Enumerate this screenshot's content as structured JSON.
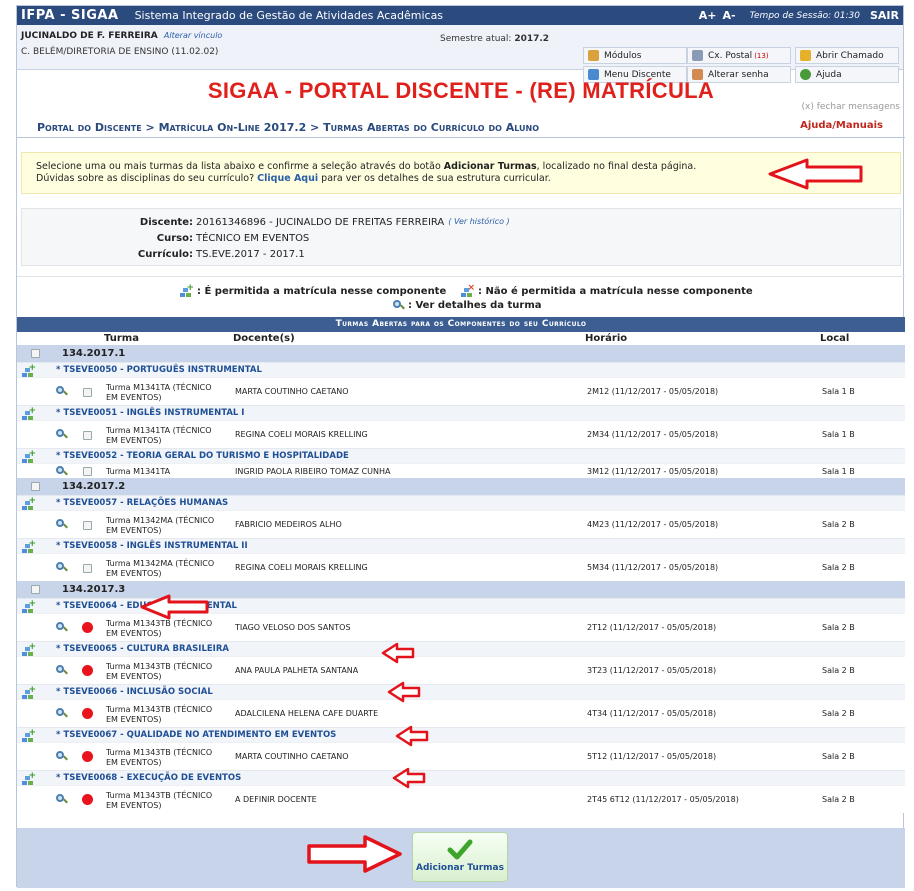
{
  "topbar": {
    "brand": "IFPA - SIGAA",
    "system": "Sistema Integrado de Gestão de Atividades Acadêmicas",
    "font_up": "A+",
    "font_down": "A-",
    "session_label": "Tempo de Sessão: 01:30",
    "exit": "SAIR"
  },
  "user": {
    "name": "JUCINALDO DE F. FERREIRA",
    "change_link": "Alterar vínculo",
    "unit": "C. BELÉM/DIRETORIA DE ENSINO (11.02.02)",
    "semester_label": "Semestre atual:",
    "semester_value": "2017.2"
  },
  "quick_buttons": {
    "modules": "Módulos",
    "mail": "Cx. Postal",
    "mail_count": "(13)",
    "ticket": "Abrir Chamado",
    "student_menu": "Menu Discente",
    "password": "Alterar senha",
    "help": "Ajuda"
  },
  "page_title": "SIGAA - PORTAL DISCENTE - (RE) MATRÍCULA",
  "close_messages": "(x) fechar mensagens",
  "breadcrumb": "Portal do Discente > Matrícula On-Line 2017.2 > Turmas Abertas do Currículo do Aluno",
  "help_link": "Ajuda/Manuais",
  "info": {
    "line1_a": "Selecione uma ou mais turmas da lista abaixo e confirme a seleção através do botão ",
    "line1_b": "Adicionar Turmas",
    "line1_c": ", localizado no final desta página.",
    "line2_a": "Dúvidas sobre as disciplinas do seu currículo? ",
    "line2_link": "Clique Aqui",
    "line2_b": " para ver os detalhes de sua estrutura curricular."
  },
  "student": {
    "discente_label": "Discente:",
    "discente_value": "20161346896 - JUCINALDO DE FREITAS FERREIRA",
    "history_link": "( Ver histórico )",
    "curso_label": "Curso:",
    "curso_value": "TÉCNICO EM EVENTOS",
    "curriculo_label": "Currículo:",
    "curriculo_value": "TS.EVE.2017 - 2017.1"
  },
  "legend": {
    "allowed": ": É permitida a matrícula nesse componente",
    "not_allowed": ": Não é permitida a matrícula nesse componente",
    "details": ": Ver detalhes da turma"
  },
  "table": {
    "title": "Turmas Abertas para os Componentes do seu Currículo",
    "col_turma": "Turma",
    "col_docente": "Docente(s)",
    "col_horario": "Horário",
    "col_local": "Local",
    "groups": [
      {
        "label": "134.2017.1",
        "components": [
          {
            "code": "* TSEVE0050 - PORTUGUÊS INSTRUMENTAL",
            "turma": "Turma M1341TA (TÉCNICO EM EVENTOS)",
            "docente": "MARTA COUTINHO CAETANO",
            "horario": "2M12 (11/12/2017 - 05/05/2018)",
            "local": "Sala 1 B",
            "selected": false
          },
          {
            "code": "* TSEVE0051 - INGLÊS INSTRUMENTAL I",
            "turma": "Turma M1341TA (TÉCNICO EM EVENTOS)",
            "docente": "REGINA COELI MORAIS KRELLING",
            "horario": "2M34 (11/12/2017 - 05/05/2018)",
            "local": "Sala 1 B",
            "selected": false
          },
          {
            "code": "* TSEVE0052 - TEORIA GERAL DO TURISMO E HOSPITALIDADE",
            "turma": "Turma M1341TA",
            "docente": "INGRID PAOLA RIBEIRO TOMAZ CUNHA",
            "horario": "3M12 (11/12/2017 - 05/05/2018)",
            "local": "Sala 1 B",
            "selected": false
          }
        ]
      },
      {
        "label": "134.2017.2",
        "components": [
          {
            "code": "* TSEVE0057 - RELAÇÕES HUMANAS",
            "turma": "Turma M1342MA (TÉCNICO EM EVENTOS)",
            "docente": "FABRICIO MEDEIROS ALHO",
            "horario": "4M23 (11/12/2017 - 05/05/2018)",
            "local": "Sala 2 B",
            "selected": false
          },
          {
            "code": "* TSEVE0058 - INGLÊS INSTRUMENTAL II",
            "turma": "Turma M1342MA (TÉCNICO EM EVENTOS)",
            "docente": "REGINA COELI MORAIS KRELLING",
            "horario": "5M34 (11/12/2017 - 05/05/2018)",
            "local": "Sala 2 B",
            "selected": false
          }
        ]
      },
      {
        "label": "134.2017.3",
        "components": [
          {
            "code": "* TSEVE0064 - EDUCAÇÃO AMBIENTAL",
            "turma": "Turma M1343TB (TÉCNICO EM EVENTOS)",
            "docente": "TIAGO VELOSO DOS SANTOS",
            "horario": "2T12 (11/12/2017 - 05/05/2018)",
            "local": "Sala 2 B",
            "selected": true
          },
          {
            "code": "* TSEVE0065 - CULTURA BRASILEIRA",
            "turma": "Turma M1343TB (TÉCNICO EM EVENTOS)",
            "docente": "ANA PAULA PALHETA SANTANA",
            "horario": "3T23 (11/12/2017 - 05/05/2018)",
            "local": "Sala 2 B",
            "selected": true
          },
          {
            "code": "* TSEVE0066 - INCLUSÃO SOCIAL",
            "turma": "Turma M1343TB (TÉCNICO EM EVENTOS)",
            "docente": "ADALCILENA HELENA CAFE DUARTE",
            "horario": "4T34 (11/12/2017 - 05/05/2018)",
            "local": "Sala 2 B",
            "selected": true
          },
          {
            "code": "* TSEVE0067 - QUALIDADE NO ATENDIMENTO EM EVENTOS",
            "turma": "Turma M1343TB (TÉCNICO EM EVENTOS)",
            "docente": "MARTA COUTINHO CAETANO",
            "horario": "5T12 (11/12/2017 - 05/05/2018)",
            "local": "Sala 2 B",
            "selected": true
          },
          {
            "code": "* TSEVE0068 - EXECUÇÃO DE EVENTOS",
            "turma": "Turma M1343TB (TÉCNICO EM EVENTOS)",
            "docente": "A DEFINIR DOCENTE",
            "horario": "2T45 6T12 (11/12/2017 - 05/05/2018)",
            "local": "Sala 2 B",
            "selected": true
          }
        ]
      }
    ]
  },
  "add_button": "Adicionar Turmas",
  "colors": {
    "header_bg": "#2b4a7e",
    "title_red": "#e0201b",
    "group_bg": "#c8d4ea",
    "annotation_red": "#e3131b"
  },
  "icons": {
    "allowed": "plus-component-icon",
    "not_allowed": "blocked-component-icon",
    "details": "magnifier-icon",
    "add": "green-check-icon",
    "annotation": "red-arrow-icon"
  }
}
